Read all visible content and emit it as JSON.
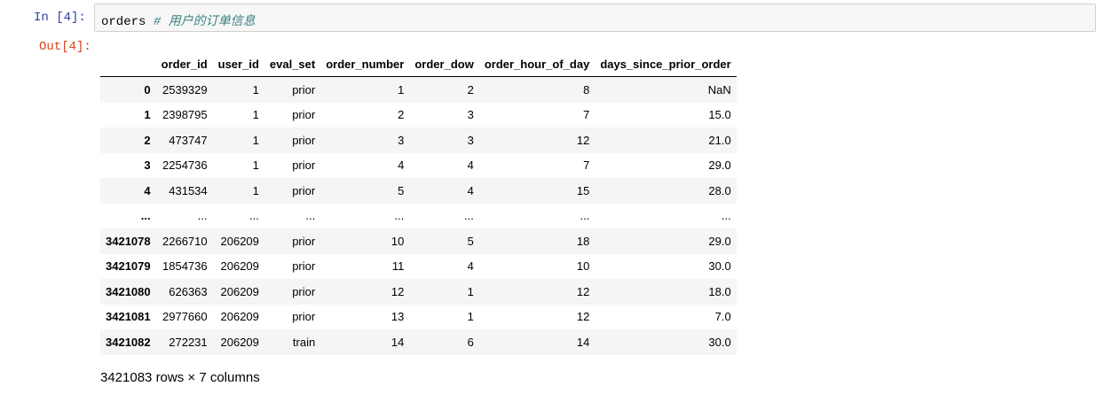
{
  "input": {
    "prompt": "In  [4]:",
    "code": "orders ",
    "comment": "# 用户的订单信息"
  },
  "output": {
    "prompt": "Out[4]:",
    "columns": [
      "",
      "order_id",
      "user_id",
      "eval_set",
      "order_number",
      "order_dow",
      "order_hour_of_day",
      "days_since_prior_order"
    ],
    "rows": [
      [
        "0",
        "2539329",
        "1",
        "prior",
        "1",
        "2",
        "8",
        "NaN"
      ],
      [
        "1",
        "2398795",
        "1",
        "prior",
        "2",
        "3",
        "7",
        "15.0"
      ],
      [
        "2",
        "473747",
        "1",
        "prior",
        "3",
        "3",
        "12",
        "21.0"
      ],
      [
        "3",
        "2254736",
        "1",
        "prior",
        "4",
        "4",
        "7",
        "29.0"
      ],
      [
        "4",
        "431534",
        "1",
        "prior",
        "5",
        "4",
        "15",
        "28.0"
      ],
      [
        "...",
        "...",
        "...",
        "...",
        "...",
        "...",
        "...",
        "..."
      ],
      [
        "3421078",
        "2266710",
        "206209",
        "prior",
        "10",
        "5",
        "18",
        "29.0"
      ],
      [
        "3421079",
        "1854736",
        "206209",
        "prior",
        "11",
        "4",
        "10",
        "30.0"
      ],
      [
        "3421080",
        "626363",
        "206209",
        "prior",
        "12",
        "1",
        "12",
        "18.0"
      ],
      [
        "3421081",
        "2977660",
        "206209",
        "prior",
        "13",
        "1",
        "12",
        "7.0"
      ],
      [
        "3421082",
        "272231",
        "206209",
        "train",
        "14",
        "6",
        "14",
        "30.0"
      ]
    ],
    "shape_text": "3421083 rows × 7 columns"
  }
}
